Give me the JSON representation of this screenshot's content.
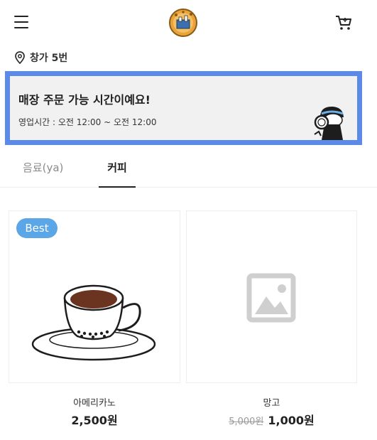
{
  "store": {
    "name": "창가 5번"
  },
  "notice": {
    "title": "매장 주문 가능 시간이예요!",
    "hours": "영업시간 : 오전 12:00 ~ 오전 12:00"
  },
  "tabs": [
    {
      "label": "음료(ya)",
      "active": false
    },
    {
      "label": "커피",
      "active": true
    }
  ],
  "products": [
    {
      "name": "아메리카노",
      "price": "2,500원",
      "badge": "Best",
      "image": "coffee-cup-icon"
    },
    {
      "name": "망고",
      "old_price": "5,000원",
      "price": "1,000원",
      "image": "image-placeholder-icon"
    }
  ],
  "colors": {
    "banner_border": "#5b8ae8",
    "banner_bg": "#f1f1f1",
    "badge_bg": "#5aa6e6",
    "logo_bg": "#e8a43a"
  }
}
